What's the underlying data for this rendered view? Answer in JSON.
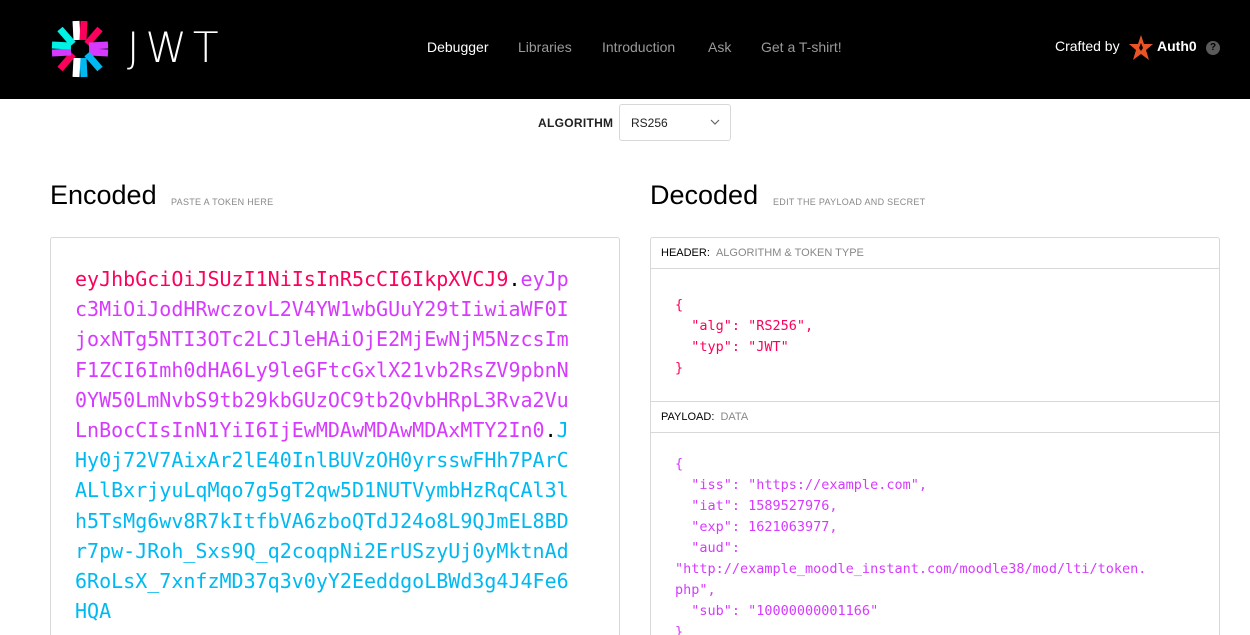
{
  "header": {
    "brand": "JWT",
    "nav": [
      {
        "label": "Debugger",
        "active": true
      },
      {
        "label": "Libraries",
        "active": false
      },
      {
        "label": "Introduction",
        "active": false
      },
      {
        "label": "Ask",
        "active": false
      },
      {
        "label": "Get a T-shirt!",
        "active": false
      }
    ],
    "crafted_by": "Crafted by",
    "auth0_label": "Auth0",
    "help_label": "?"
  },
  "algorithm": {
    "label": "ALGORITHM",
    "selected": "RS256"
  },
  "encoded": {
    "title": "Encoded",
    "subtitle": "PASTE A TOKEN HERE",
    "token_header": "eyJhbGciOiJSUzI1NiIsInR5cCI6IkpXVCJ9",
    "token_payload": "eyJpc3MiOiJodHRwczovL2V4YW1wbGUuY29tIiwiaWF0IjoxNTg5NTI3OTc2LCJleHAiOjE2MjEwNjM5NzcsImF1ZCI6Imh0dHA6Ly9leGFtcGxlX21vb2RsZV9pbnN0YW50LmNvbS9tb29kbGUzOC9tb2QvbHRpL3Rva2VuLnBocCIsInN1YiI6IjEwMDAwMDAwMDAxMTY2In0",
    "token_signature": "JHy0j72V7AixAr2lE40InlBUVzOH0yrsswFHh7PArCALlBxrjyuLqMqo7g5gT2qw5D1NUTVymbHzRqCAl3lh5TsMg6wv8R7kItfbVA6zboQTdJ24o8L9QJmEL8BDr7pw-JRoh_Sxs9Q_q2coqpNi2ErUSzyUj0yMktnAd6RoLsX_7xnfzMD37q3v0yY2EeddgoLBWd3g4J4Fe6HQA",
    "dot": "."
  },
  "decoded": {
    "title": "Decoded",
    "subtitle": "EDIT THE PAYLOAD AND SECRET",
    "header_panel": {
      "title": "HEADER:",
      "subtitle": "ALGORITHM & TOKEN TYPE",
      "json_text": "{\n  \"alg\": \"RS256\",\n  \"typ\": \"JWT\"\n}"
    },
    "payload_panel": {
      "title": "PAYLOAD:",
      "subtitle": "DATA",
      "json_text": "{\n  \"iss\": \"https://example.com\",\n  \"iat\": 1589527976,\n  \"exp\": 1621063977,\n  \"aud\":\n\"http://example_moodle_instant.com/moodle38/mod/lti/token.\nphp\",\n  \"sub\": \"10000000001166\"\n}"
    }
  },
  "colors": {
    "header_part": "#fb015b",
    "payload_part": "#d63aff",
    "signature_part": "#00b9f1"
  }
}
